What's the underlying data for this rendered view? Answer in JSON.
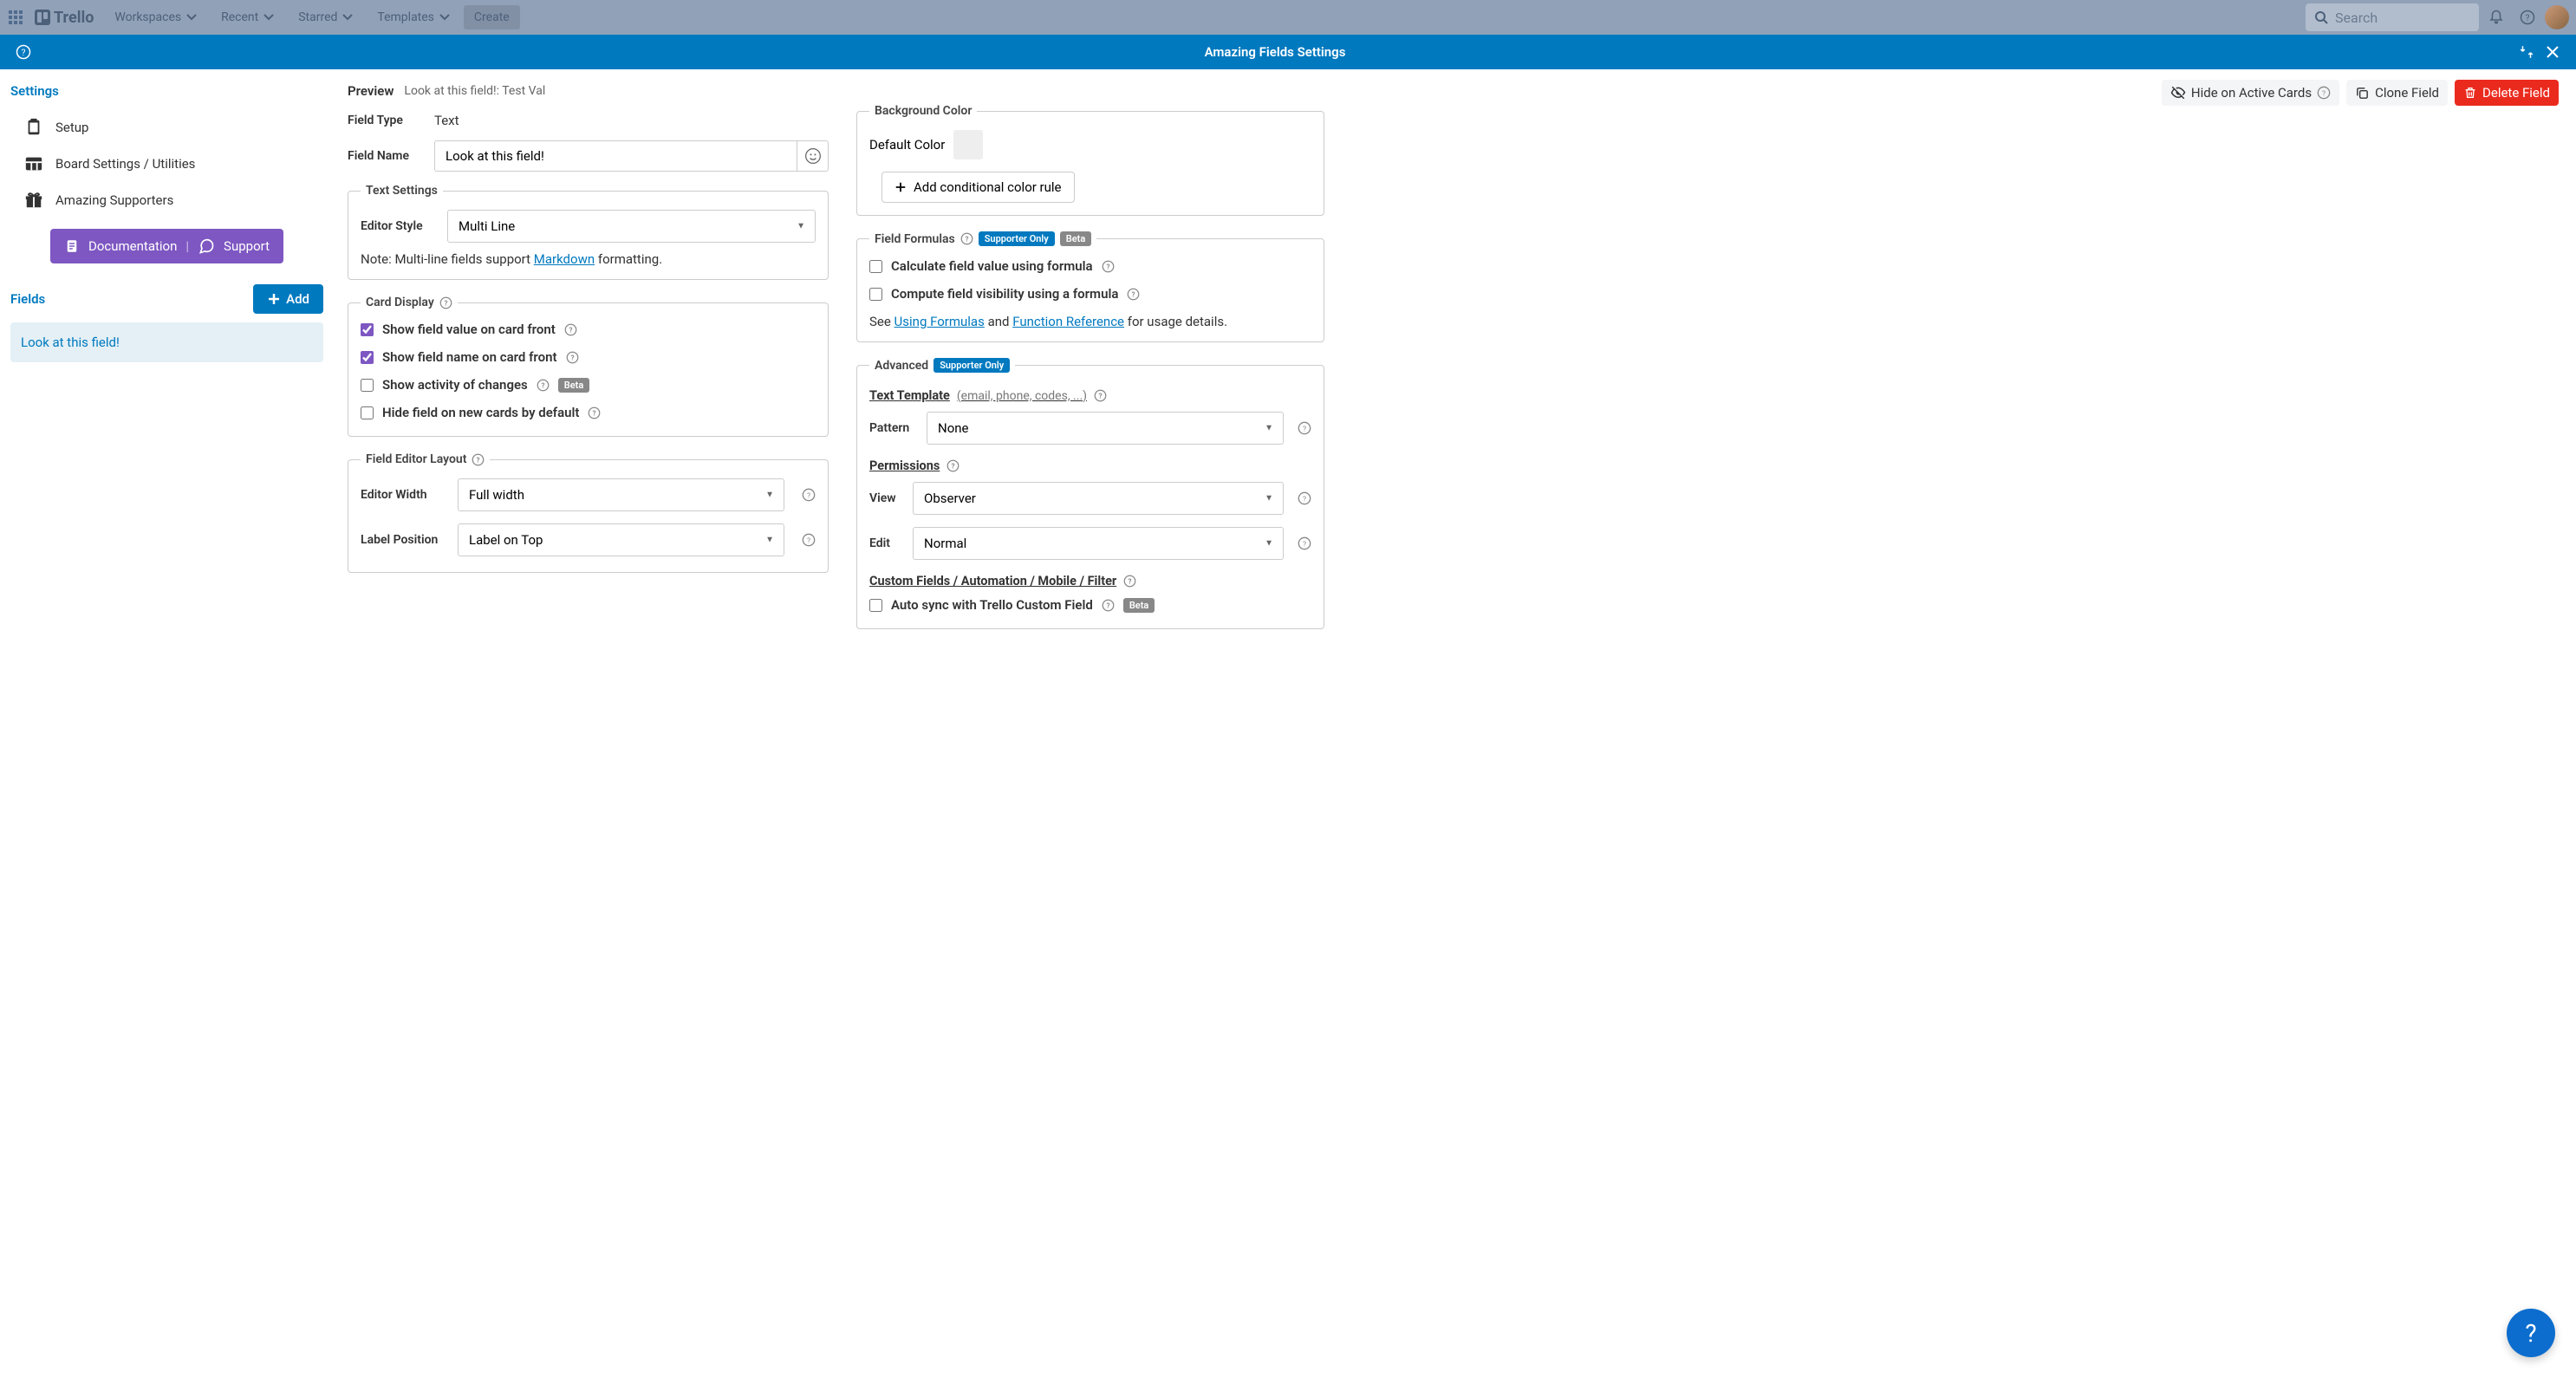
{
  "nav": {
    "brand": "Trello",
    "items": [
      "Workspaces",
      "Recent",
      "Starred",
      "Templates"
    ],
    "create": "Create",
    "search_placeholder": "Search"
  },
  "header": {
    "title": "Amazing Fields Settings"
  },
  "sidebar": {
    "title": "Settings",
    "items": [
      {
        "label": "Setup"
      },
      {
        "label": "Board Settings / Utilities"
      },
      {
        "label": "Amazing Supporters"
      }
    ],
    "doc": "Documentation",
    "support": "Support",
    "fields_title": "Fields",
    "add_label": "Add",
    "field_items": [
      "Look at this field!"
    ]
  },
  "actions": {
    "hide": "Hide on Active Cards",
    "clone": "Clone Field",
    "delete": "Delete Field"
  },
  "preview": {
    "label": "Preview",
    "value": "Look at this field!: Test Val"
  },
  "field_type": {
    "label": "Field Type",
    "value": "Text"
  },
  "field_name": {
    "label": "Field Name",
    "value": "Look at this field!"
  },
  "text_settings": {
    "legend": "Text Settings",
    "editor_style_label": "Editor Style",
    "editor_style_value": "Multi Line",
    "note_prefix": "Note: Multi-line fields support ",
    "note_link": "Markdown",
    "note_suffix": " formatting."
  },
  "card_display": {
    "legend": "Card Display",
    "show_value": "Show field value on card front",
    "show_name": "Show field name on card front",
    "show_activity": "Show activity of changes",
    "beta": "Beta",
    "hide_default": "Hide field on new cards by default"
  },
  "editor_layout": {
    "legend": "Field Editor Layout",
    "width_label": "Editor Width",
    "width_value": "Full width",
    "pos_label": "Label Position",
    "pos_value": "Label on Top"
  },
  "bg_color": {
    "legend": "Background Color",
    "default_label": "Default Color",
    "add_rule": "Add conditional color rule"
  },
  "formulas": {
    "legend": "Field Formulas",
    "supporter": "Supporter Only",
    "beta": "Beta",
    "calc_value": "Calculate field value using formula",
    "calc_visibility": "Compute field visibility using a formula",
    "see": "See ",
    "link1": "Using Formulas",
    "and": " and ",
    "link2": "Function Reference",
    "suffix": " for usage details."
  },
  "advanced": {
    "legend": "Advanced",
    "supporter": "Supporter Only",
    "template_label": "Text Template",
    "template_sub": "(email, phone, codes, ...)",
    "pattern_label": "Pattern",
    "pattern_value": "None",
    "permissions_label": "Permissions",
    "view_label": "View",
    "view_value": "Observer",
    "edit_label": "Edit",
    "edit_value": "Normal",
    "sync_heading": "Custom Fields / Automation / Mobile / Filter",
    "sync_check": "Auto sync with Trello Custom Field",
    "sync_beta": "Beta"
  }
}
